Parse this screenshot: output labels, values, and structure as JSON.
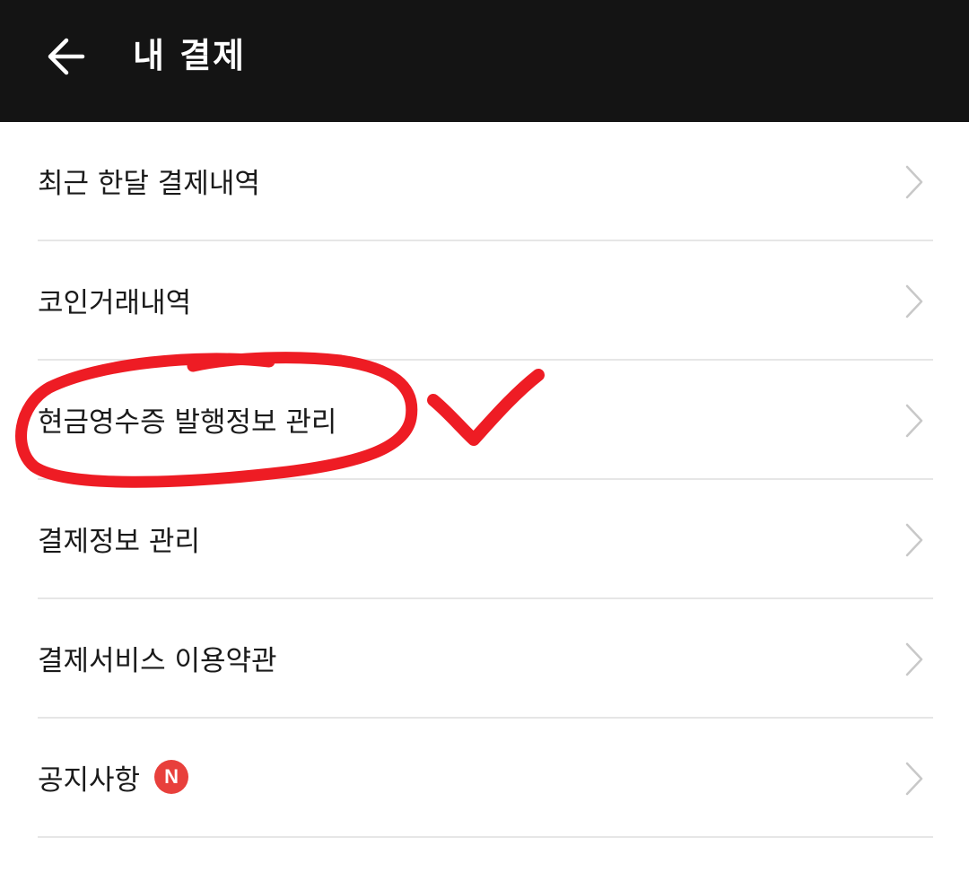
{
  "header": {
    "title": "내 결제",
    "back_icon": "arrow-left-icon"
  },
  "menu": {
    "items": [
      {
        "label": "최근 한달 결제내역"
      },
      {
        "label": "코인거래내역"
      },
      {
        "label": "현금영수증 발행정보 관리"
      },
      {
        "label": "결제정보 관리"
      },
      {
        "label": "결제서비스 이용약관"
      },
      {
        "label": "공지사항",
        "badge": "N"
      }
    ],
    "chevron_icon": "chevron-right-icon"
  },
  "colors": {
    "header_bg": "#141414",
    "badge_bg": "#e8403c",
    "annotation": "#ee1c24"
  }
}
